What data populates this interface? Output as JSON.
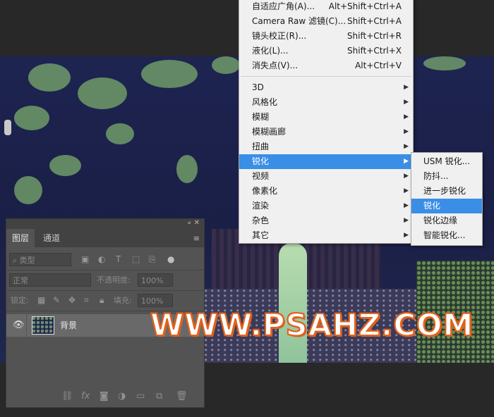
{
  "menu": {
    "items": [
      {
        "label": "自适应广角(A)...",
        "shortcut": "Alt+Shift+Ctrl+A"
      },
      {
        "label": "Camera Raw 滤镜(C)...",
        "shortcut": "Shift+Ctrl+A"
      },
      {
        "label": "镜头校正(R)...",
        "shortcut": "Shift+Ctrl+R"
      },
      {
        "label": "液化(L)...",
        "shortcut": "Shift+Ctrl+X"
      },
      {
        "label": "消失点(V)...",
        "shortcut": "Alt+Ctrl+V"
      },
      {
        "label": "3D"
      },
      {
        "label": "风格化"
      },
      {
        "label": "模糊"
      },
      {
        "label": "模糊画廊"
      },
      {
        "label": "扭曲"
      },
      {
        "label": "锐化"
      },
      {
        "label": "视频"
      },
      {
        "label": "像素化"
      },
      {
        "label": "渲染"
      },
      {
        "label": "杂色"
      },
      {
        "label": "其它"
      }
    ],
    "submenu_arrow": "▶",
    "highlight_color": "#3a8ee6"
  },
  "submenu": {
    "items": [
      "USM 锐化...",
      "防抖...",
      "进一步锐化",
      "锐化",
      "锐化边缘",
      "智能锐化..."
    ]
  },
  "layers_panel": {
    "collapse_glyph": "«",
    "close_glyph": "✕",
    "tabs": [
      "图层",
      "通道"
    ],
    "menu_glyph": "≡",
    "filter_kind": "类型",
    "blend_mode": "正常",
    "opacity_label": "不透明度:",
    "opacity_value": "100%",
    "lock_label": "锁定:",
    "fill_label": "填充:",
    "fill_value": "100%",
    "layer": {
      "name": "背景"
    }
  },
  "watermark": "WWW.PSAHZ.COM"
}
